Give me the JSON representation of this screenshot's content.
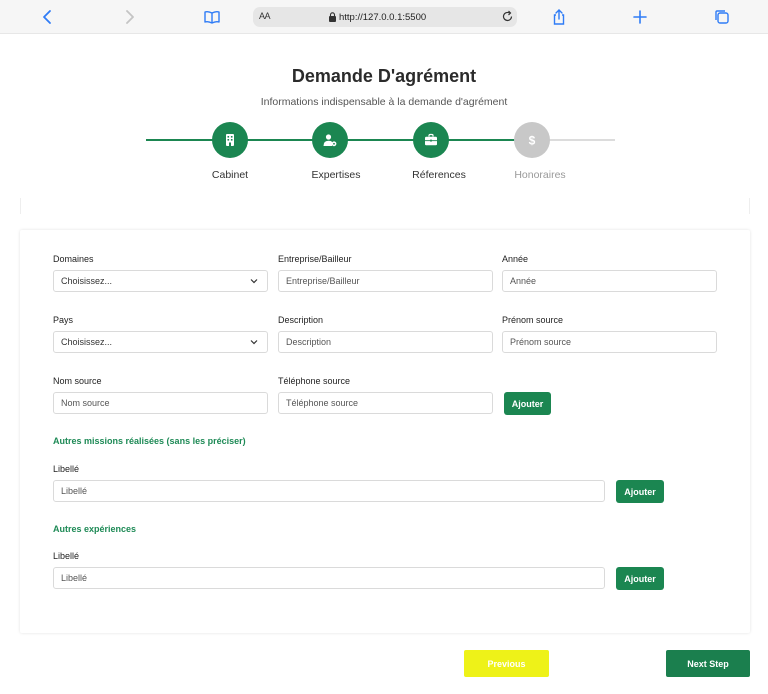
{
  "browser": {
    "text_size_label": "AA",
    "url": "http://127.0.0.1:5500"
  },
  "header": {
    "title": "Demande D'agrément",
    "subtitle": "Informations indispensable à la demande d'agrément"
  },
  "stepper": {
    "active_color": "#1b8651",
    "inactive_color": "#c8c8c8",
    "steps": [
      {
        "label": "Cabinet",
        "icon": "building-icon",
        "state": "complete"
      },
      {
        "label": "Expertises",
        "icon": "user-gear-icon",
        "state": "complete"
      },
      {
        "label": "Réferences",
        "icon": "briefcase-icon",
        "state": "active"
      },
      {
        "label": "Honoraires",
        "icon": "dollar-icon",
        "state": "inactive"
      }
    ]
  },
  "form": {
    "domaines": {
      "label": "Domaines",
      "value": "Choisissez..."
    },
    "entreprise": {
      "label": "Entreprise/Bailleur",
      "placeholder": "Entreprise/Bailleur"
    },
    "annee": {
      "label": "Année",
      "placeholder": "Année"
    },
    "pays": {
      "label": "Pays",
      "value": "Choisissez..."
    },
    "description": {
      "label": "Description",
      "placeholder": "Description"
    },
    "prenom_source": {
      "label": "Prénom source",
      "placeholder": "Prénom source"
    },
    "nom_source": {
      "label": "Nom source",
      "placeholder": "Nom source"
    },
    "telephone_source": {
      "label": "Téléphone source",
      "placeholder": "Téléphone source"
    },
    "add_label": "Ajouter",
    "missions": {
      "title": "Autres missions réalisées (sans les préciser)",
      "label": "Libellé",
      "placeholder": "Libellé",
      "add_label": "Ajouter"
    },
    "experiences": {
      "title": "Autres expériences",
      "label": "Libellé",
      "placeholder": "Libellé",
      "add_label": "Ajouter"
    }
  },
  "footer": {
    "previous_label": "Previous",
    "next_label": "Next Step",
    "previous_color": "#eef218",
    "next_color": "#1b7f4e"
  }
}
